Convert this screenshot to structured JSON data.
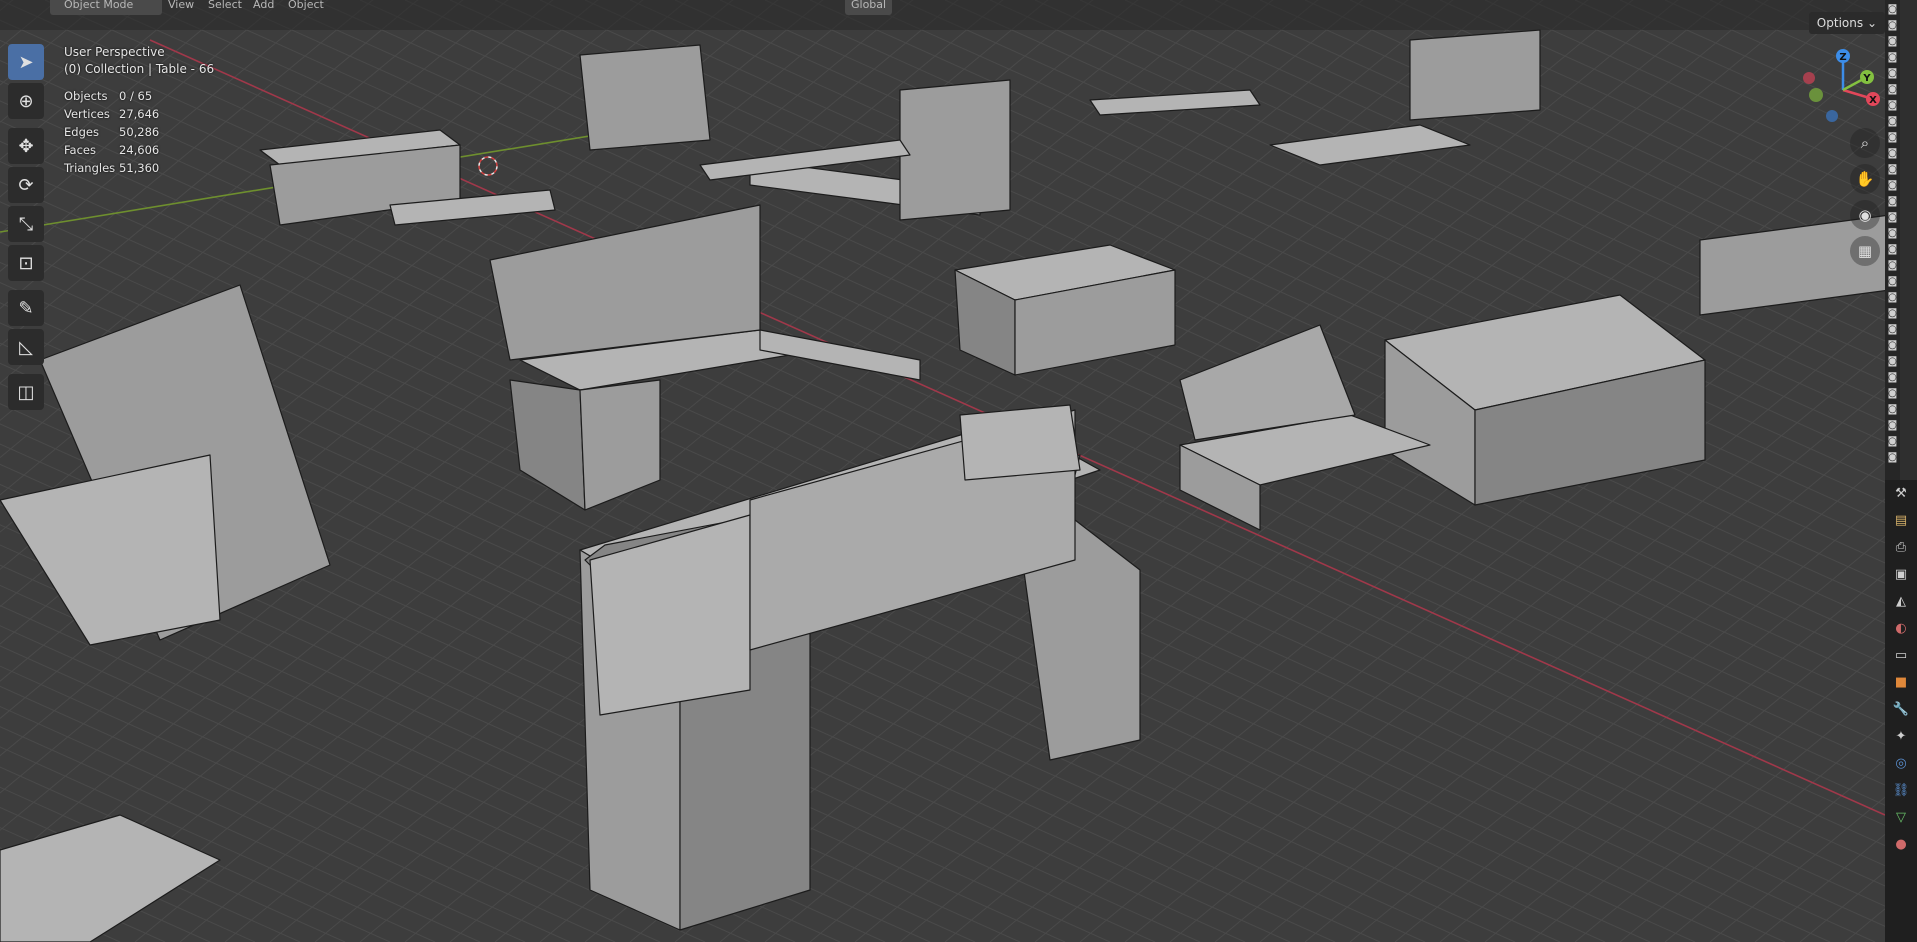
{
  "header": {
    "mode": "Object Mode",
    "menus": [
      "View",
      "Select",
      "Add",
      "Object"
    ],
    "transform_orientation": "Global",
    "options": "Options"
  },
  "viewport_info": {
    "view_name": "User Perspective",
    "collection_line": "(0) Collection | Table - 66",
    "stats": [
      {
        "label": "Objects",
        "value": "0 / 65"
      },
      {
        "label": "Vertices",
        "value": "27,646"
      },
      {
        "label": "Edges",
        "value": "50,286"
      },
      {
        "label": "Faces",
        "value": "24,606"
      },
      {
        "label": "Triangles",
        "value": "51,360"
      }
    ]
  },
  "tools": [
    {
      "name": "select-box-tool",
      "icon": "cursor-arrow",
      "active": true
    },
    {
      "name": "cursor-tool",
      "icon": "3d-cursor",
      "active": false
    },
    {
      "name": "move-tool",
      "icon": "move-arrows",
      "active": false
    },
    {
      "name": "rotate-tool",
      "icon": "rotate",
      "active": false
    },
    {
      "name": "scale-tool",
      "icon": "scale",
      "active": false
    },
    {
      "name": "transform-tool",
      "icon": "transform",
      "active": false
    },
    {
      "name": "annotate-tool",
      "icon": "pencil",
      "active": false
    },
    {
      "name": "measure-tool",
      "icon": "ruler",
      "active": false
    },
    {
      "name": "add-cube-tool",
      "icon": "cube-add",
      "active": false
    }
  ],
  "gizmo": {
    "x_label": "X",
    "y_label": "Y",
    "z_label": "Z",
    "x_color": "#e2475a",
    "y_color": "#83c040",
    "z_color": "#3c8de8"
  },
  "colors": {
    "viewport_bg": "#3d3d3d",
    "grid": "#4a4a4a",
    "x_axis": "#a0384a",
    "y_axis": "#6e8f2e",
    "model_face": "#a3a3a3",
    "model_edge": "#1c1c1c",
    "active_tool": "#4a6fa5"
  },
  "property_tabs": [
    "tool",
    "render",
    "output",
    "view-layer",
    "scene",
    "world",
    "collection",
    "object",
    "modifiers",
    "particles",
    "physics",
    "constraints",
    "data",
    "material"
  ]
}
